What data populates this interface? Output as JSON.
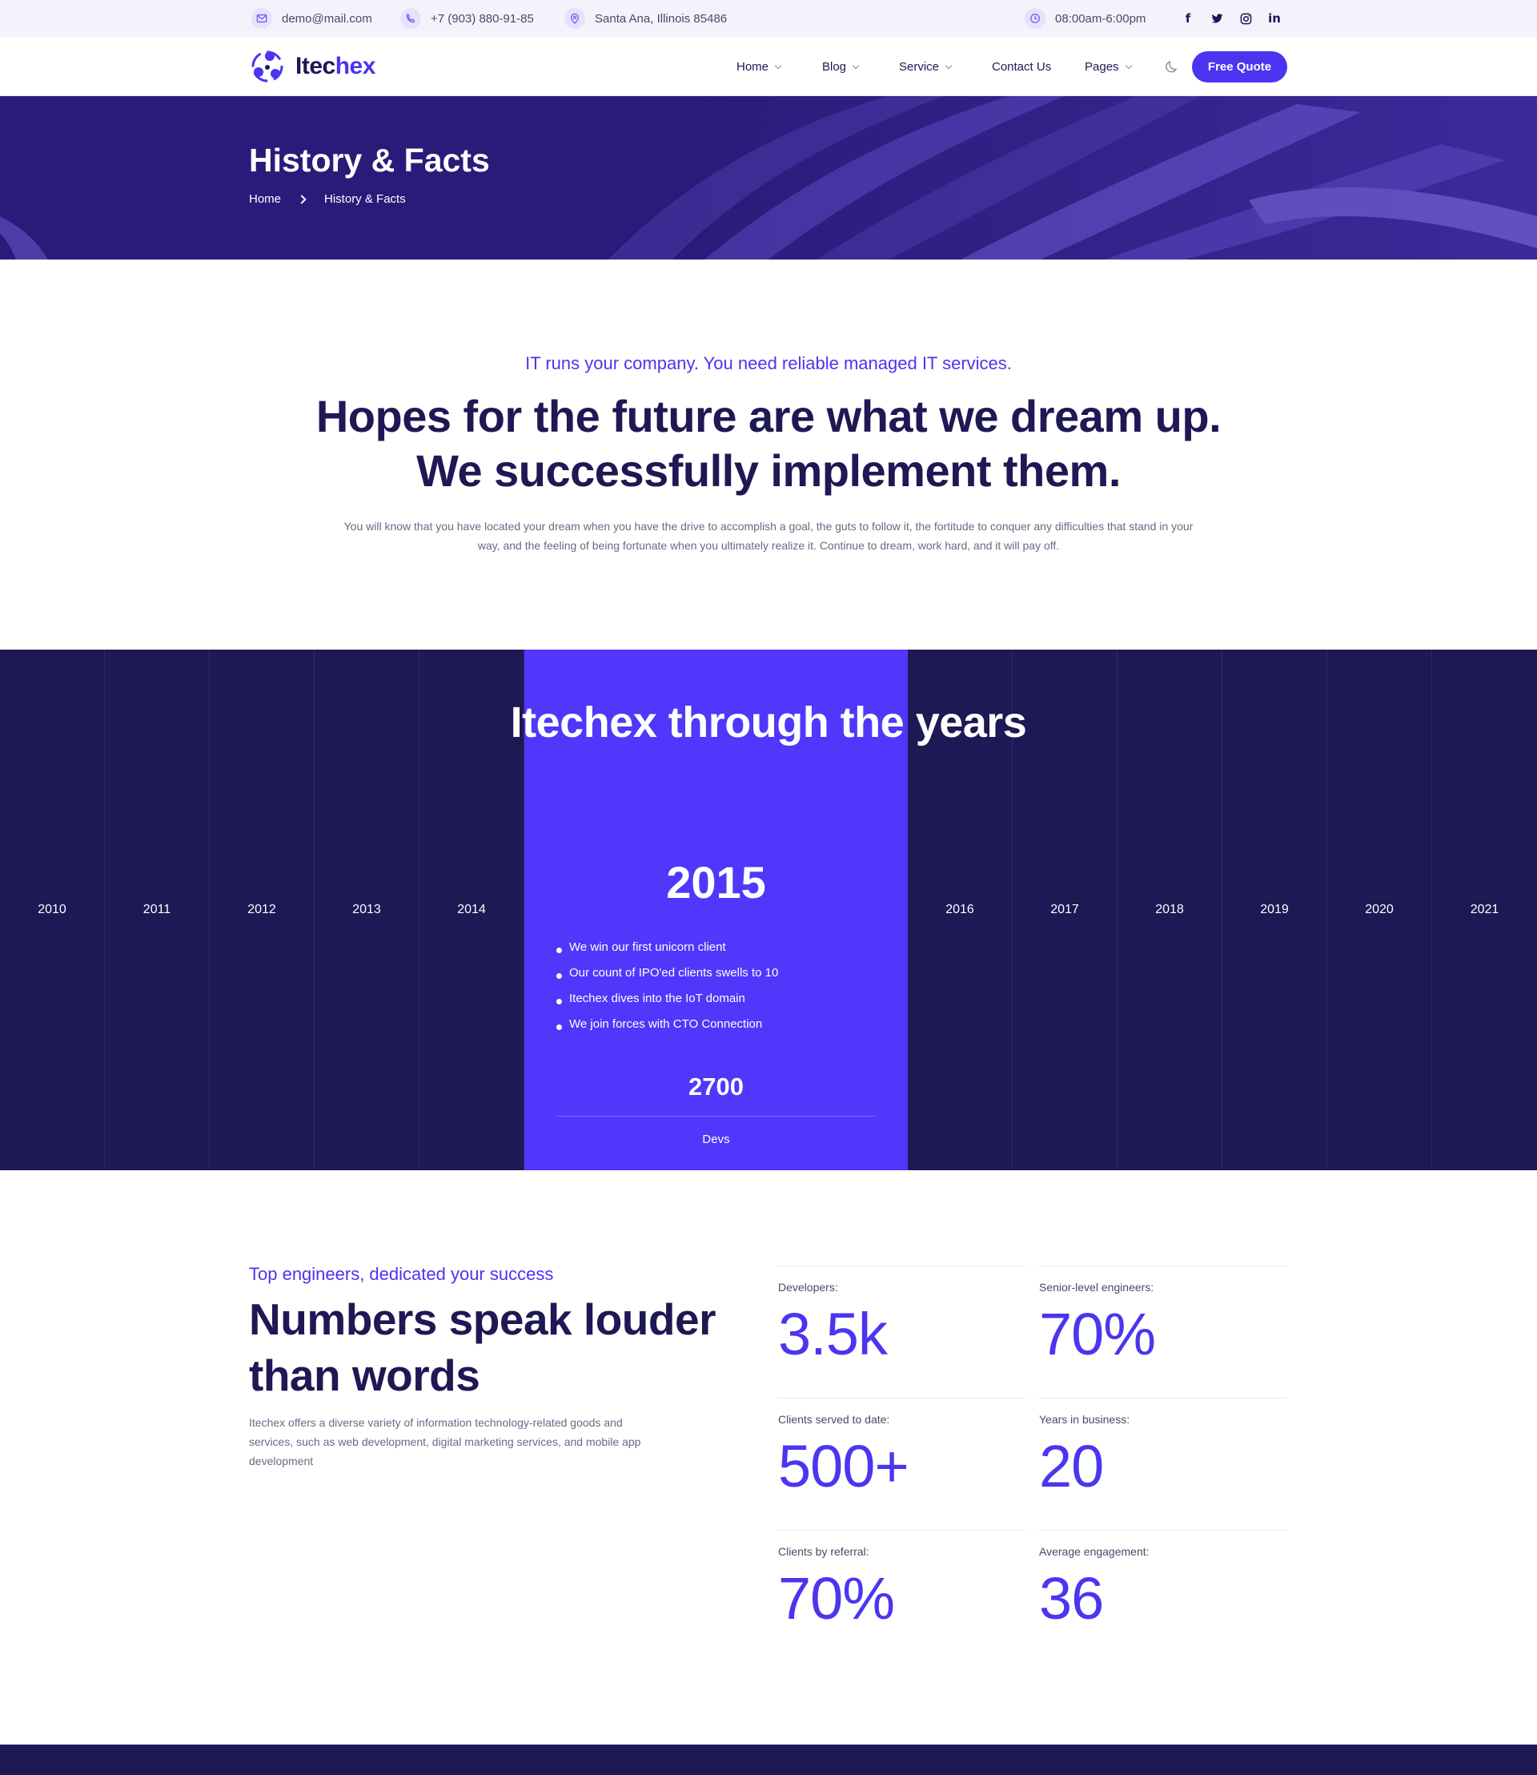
{
  "topbar": {
    "email": "demo@mail.com",
    "phone": "+7 (903) 880-91-85",
    "address": "Santa Ana, Illinois 85486",
    "hours": "08:00am-6:00pm",
    "social_icons": [
      "facebook-icon",
      "twitter-icon",
      "instagram-icon",
      "linkedin-icon"
    ]
  },
  "brand": {
    "name_start": "Itec",
    "name_end": "hex"
  },
  "nav": {
    "items": [
      {
        "label": "Home",
        "dropdown": true
      },
      {
        "label": "Blog",
        "dropdown": true
      },
      {
        "label": "Service",
        "dropdown": true
      },
      {
        "label": "Contact Us",
        "dropdown": false
      },
      {
        "label": "Pages",
        "dropdown": true
      }
    ],
    "cta": "Free Quote"
  },
  "hero": {
    "title": "History & Facts",
    "breadcrumb": [
      "Home",
      "History & Facts"
    ]
  },
  "intro": {
    "eyebrow": "IT runs your company. You need reliable managed IT services.",
    "heading": "Hopes for the future are what we dream up. We successfully implement them.",
    "paragraph": "You will know that you have located your dream when you have the drive to accomplish a goal, the guts to follow it, the fortitude to conquer any difficulties that stand in your way, and the feeling of being fortunate when you ultimately realize it. Continue to dream, work hard, and it will pay off."
  },
  "timeline": {
    "heading": "Itechex through the years",
    "years_before": [
      "2010",
      "2011",
      "2012",
      "2013",
      "2014"
    ],
    "years_after": [
      "2016",
      "2017",
      "2018",
      "2019",
      "2020",
      "2021"
    ],
    "active": {
      "year": "2015",
      "points": [
        "We win our first unicorn client",
        "Our count of IPO'ed clients swells to 10",
        "Itechex dives into the IoT domain",
        "We join forces with CTO Connection"
      ],
      "count": "2700",
      "count_label": "Devs"
    }
  },
  "numbers": {
    "eyebrow": "Top engineers, dedicated your success",
    "heading": "Numbers speak louder than words",
    "paragraph": "Itechex offers a diverse variety of information technology-related goods and services, such as web development, digital marketing services, and mobile app development",
    "stats": [
      {
        "label": "Developers:",
        "value": "3.5k"
      },
      {
        "label": "Senior-level engineers:",
        "value": "70%"
      },
      {
        "label": "Clients served to date:",
        "value": "500+"
      },
      {
        "label": "Years in business:",
        "value": "20"
      },
      {
        "label": "Clients by referral:",
        "value": "70%"
      },
      {
        "label": "Average engagement:",
        "value": "36"
      }
    ]
  },
  "colors": {
    "accent": "#4b35f0",
    "dark": "#1e1854",
    "hero": "#2a1b7a",
    "timeline_active": "#5037fb"
  }
}
